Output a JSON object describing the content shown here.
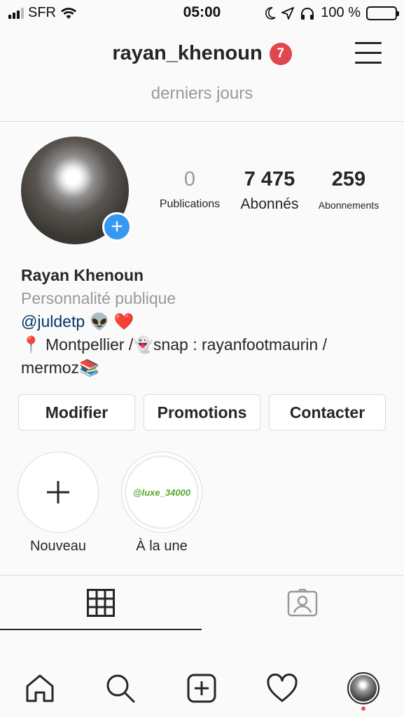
{
  "status_bar": {
    "carrier": "SFR",
    "time": "05:00",
    "battery_percent": "100 %"
  },
  "header": {
    "username": "rayan_khenoun",
    "notification_count": "7"
  },
  "subtitle": "derniers jours",
  "stats": {
    "posts": {
      "count": "0",
      "label": "Publications"
    },
    "followers": {
      "count": "7 475",
      "label": "Abonnés"
    },
    "following": {
      "count": "259",
      "label": "Abonnements"
    }
  },
  "bio": {
    "name": "Rayan Khenoun",
    "category": "Personnalité publique",
    "mention": "@juldetp",
    "mention_emojis": "👽 ❤️",
    "line1": "📍 Montpellier /👻snap : rayanfootmaurin /",
    "line2": "mermoz📚"
  },
  "buttons": {
    "edit": "Modifier",
    "promotions": "Promotions",
    "contact": "Contacter"
  },
  "highlights": {
    "new_label": "Nouveau",
    "featured_label": "À la une",
    "featured_preview_text": "@luxe_34000"
  },
  "colors": {
    "accent_blue": "#3897f0",
    "badge_red": "#e0474c",
    "mention": "#003569"
  },
  "icons": {
    "tab_grid": "grid-icon",
    "tab_tagged": "tagged-icon",
    "nav": [
      "home-icon",
      "search-icon",
      "add-post-icon",
      "heart-icon",
      "profile-avatar"
    ]
  }
}
